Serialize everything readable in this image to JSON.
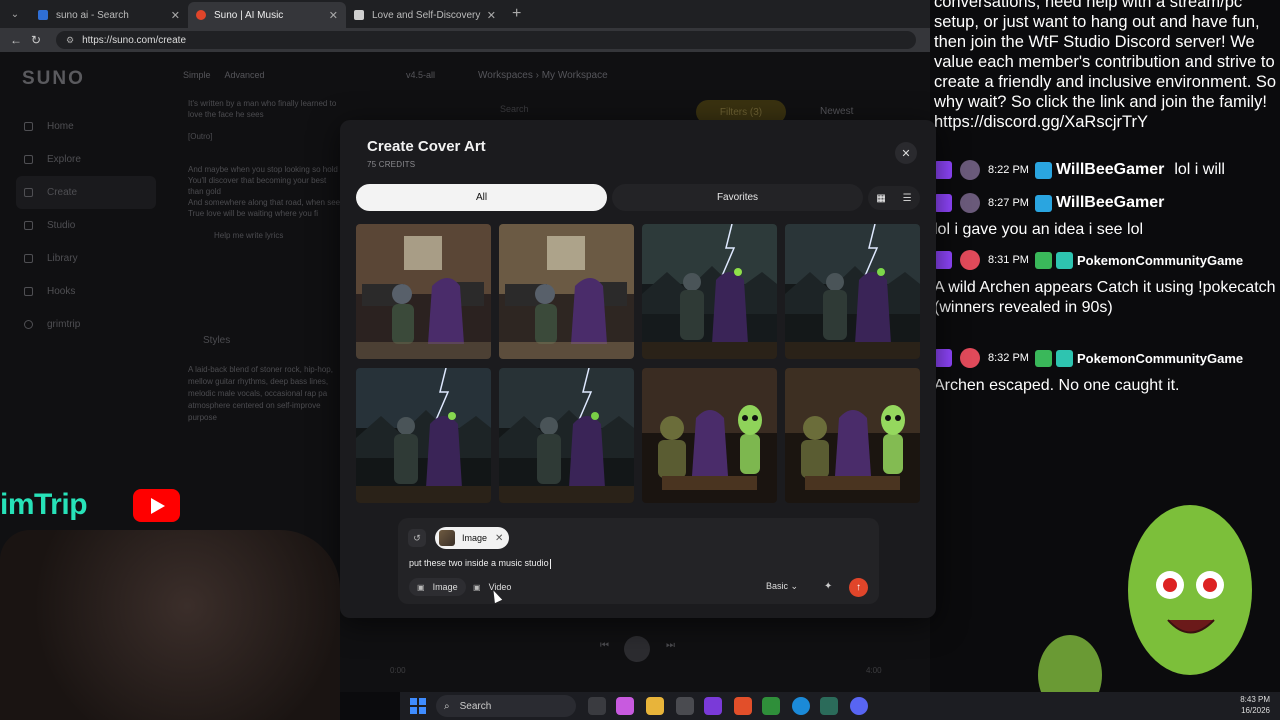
{
  "browser": {
    "tabs": [
      {
        "title": "suno ai - Search",
        "active": false,
        "favicon_color": "#2f6fd6"
      },
      {
        "title": "Suno | AI Music",
        "active": true,
        "favicon_color": "#e0452a"
      },
      {
        "title": "Love and Self-Discovery",
        "active": false,
        "favicon_color": "#cfcfcf"
      }
    ],
    "url": "https://suno.com/create"
  },
  "suno": {
    "logo": "SUNO",
    "nav": [
      "Home",
      "Explore",
      "Create",
      "Studio",
      "Library",
      "Hooks",
      "grimtrip"
    ],
    "modes": [
      "Simple",
      "Advanced"
    ],
    "version": "v4.5-all",
    "lyrics": [
      "It's written by a man who finally learned to love the face he sees",
      "[Outro]",
      "And maybe when you stop looking so hold",
      "You'll discover that becoming your best than gold",
      "And somewhere along that road, when see",
      "True love will be waiting where you fi"
    ],
    "lyrics_help": "Help me write lyrics",
    "styles_header": "Styles",
    "styles_text": "A laid-back blend of stoner rock, hip-hop, mellow guitar rhythms, deep bass lines, melodic male vocals, occasional rap pa atmosphere centered on self-improve purpose",
    "workspace": "Workspaces  ›  My Workspace",
    "search_placeholder": "Search",
    "filters": "Filters (3)",
    "sort": "Newest",
    "player": {
      "time_start": "0:00",
      "time_end": "4:00"
    }
  },
  "modal": {
    "title": "Create Cover Art",
    "credits": "75 CREDITS",
    "tabs": {
      "all": "All",
      "favorites": "Favorites"
    },
    "images": [
      {
        "scene": "studio",
        "palette": [
          "#5a4636",
          "#2b2220",
          "#6e5d47"
        ]
      },
      {
        "scene": "studio",
        "palette": [
          "#6b5a44",
          "#2e2622",
          "#8a7356"
        ]
      },
      {
        "scene": "storm",
        "palette": [
          "#2d3a3a",
          "#151a1c",
          "#8fe04a"
        ]
      },
      {
        "scene": "storm",
        "palette": [
          "#2a3538",
          "#141819",
          "#7cd84a"
        ]
      },
      {
        "scene": "storm",
        "palette": [
          "#273239",
          "#121617",
          "#86d84f"
        ]
      },
      {
        "scene": "storm",
        "palette": [
          "#283236",
          "#131718",
          "#79cf46"
        ]
      },
      {
        "scene": "aliens",
        "palette": [
          "#3a2c22",
          "#1a1410",
          "#8fd35a"
        ]
      },
      {
        "scene": "aliens",
        "palette": [
          "#3d2f22",
          "#1b1510",
          "#95d85e"
        ]
      }
    ],
    "chip_label": "Image",
    "prompt": "put these two inside a music studio",
    "buttons": {
      "image": "Image",
      "video": "Video"
    },
    "model": "Basic"
  },
  "chat": {
    "intro": "conversations, need help with a stream/pc setup, or just want to hang out and have fun, then join the WtF Studio Discord server! We value each member's contribution and strive to create a friendly and inclusive environment. So why wait? So click the link and join the family! https://discord.gg/XaRscjrTrY",
    "messages": [
      {
        "time": "8:22 PM",
        "user": "WillBeeGamer",
        "text": "lol i will",
        "inline": true
      },
      {
        "time": "8:27 PM",
        "user": "WillBeeGamer",
        "text": "lol i gave you an idea i see lol",
        "inline": false
      },
      {
        "time": "8:31 PM",
        "user": "PokemonCommunityGame",
        "text": "A wild Archen appears Catch it using !pokecatch (winners revealed in 90s)",
        "inline": false
      },
      {
        "time": "8:32 PM",
        "user": "PokemonCommunityGame",
        "text": "Archen escaped. No one caught it.",
        "inline": false
      }
    ]
  },
  "overlay": {
    "brand": "imTrip"
  },
  "taskbar": {
    "search": "Search",
    "time": "8:43 PM",
    "date": "16/2026"
  }
}
